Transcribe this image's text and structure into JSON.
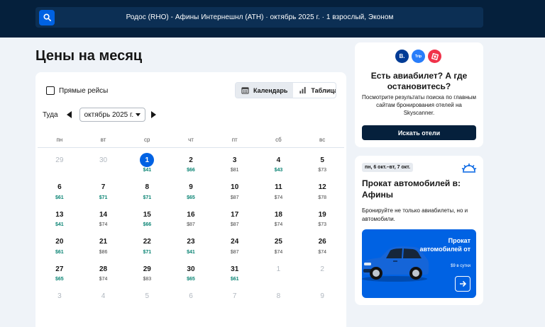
{
  "header": {
    "search_summary": "Родос (RHO) - Афины Интернешнл (ATH)  ·  октябрь 2025 г.  ·  1 взрослый, Эконом"
  },
  "page_title": "Цены на месяц",
  "filters": {
    "direct_flights_label": "Прямые рейсы",
    "direct_flights_checked": false,
    "views": [
      {
        "label": "Календарь",
        "icon": "calendar-icon",
        "active": true
      },
      {
        "label": "Таблица",
        "icon": "bar-chart-icon",
        "active": false
      }
    ]
  },
  "month_nav": {
    "direction_label": "Туда",
    "selected_month": "октябрь 2025 г."
  },
  "weekdays": [
    "пн",
    "вт",
    "ср",
    "чт",
    "пт",
    "сб",
    "вс"
  ],
  "days": [
    {
      "day": "29",
      "price": "",
      "state": "muted"
    },
    {
      "day": "30",
      "price": "",
      "state": "muted"
    },
    {
      "day": "1",
      "price": "$41",
      "state": "selected",
      "level": "low"
    },
    {
      "day": "2",
      "price": "$66",
      "level": "low"
    },
    {
      "day": "3",
      "price": "$81",
      "level": "mid"
    },
    {
      "day": "4",
      "price": "$43",
      "level": "low"
    },
    {
      "day": "5",
      "price": "$73",
      "level": "mid"
    },
    {
      "day": "6",
      "price": "$61",
      "level": "low"
    },
    {
      "day": "7",
      "price": "$71",
      "level": "low"
    },
    {
      "day": "8",
      "price": "$71",
      "level": "low"
    },
    {
      "day": "9",
      "price": "$65",
      "level": "low"
    },
    {
      "day": "10",
      "price": "$87",
      "level": "mid"
    },
    {
      "day": "11",
      "price": "$74",
      "level": "mid"
    },
    {
      "day": "12",
      "price": "$78",
      "level": "mid"
    },
    {
      "day": "13",
      "price": "$41",
      "level": "low"
    },
    {
      "day": "14",
      "price": "$74",
      "level": "mid"
    },
    {
      "day": "15",
      "price": "$66",
      "level": "low"
    },
    {
      "day": "16",
      "price": "$87",
      "level": "mid"
    },
    {
      "day": "17",
      "price": "$87",
      "level": "mid"
    },
    {
      "day": "18",
      "price": "$74",
      "level": "mid"
    },
    {
      "day": "19",
      "price": "$73",
      "level": "mid"
    },
    {
      "day": "20",
      "price": "$61",
      "level": "low"
    },
    {
      "day": "21",
      "price": "$86",
      "level": "mid"
    },
    {
      "day": "22",
      "price": "$71",
      "level": "low"
    },
    {
      "day": "23",
      "price": "$41",
      "level": "low"
    },
    {
      "day": "24",
      "price": "$87",
      "level": "mid"
    },
    {
      "day": "25",
      "price": "$74",
      "level": "mid"
    },
    {
      "day": "26",
      "price": "$74",
      "level": "mid"
    },
    {
      "day": "27",
      "price": "$65",
      "level": "low"
    },
    {
      "day": "28",
      "price": "$74",
      "level": "mid"
    },
    {
      "day": "29",
      "price": "$83",
      "level": "mid"
    },
    {
      "day": "30",
      "price": "$65",
      "level": "low"
    },
    {
      "day": "31",
      "price": "$61",
      "level": "low"
    },
    {
      "day": "1",
      "price": "",
      "state": "muted"
    },
    {
      "day": "2",
      "price": "",
      "state": "muted"
    },
    {
      "day": "3",
      "price": "",
      "state": "muted"
    },
    {
      "day": "4",
      "price": "",
      "state": "muted"
    },
    {
      "day": "5",
      "price": "",
      "state": "muted"
    },
    {
      "day": "6",
      "price": "",
      "state": "muted"
    },
    {
      "day": "7",
      "price": "",
      "state": "muted"
    },
    {
      "day": "8",
      "price": "",
      "state": "muted"
    },
    {
      "day": "9",
      "price": "",
      "state": "muted"
    }
  ],
  "hotels_card": {
    "logos": [
      {
        "text": "B.",
        "color": "#003b95",
        "icon": "booking-logo-icon"
      },
      {
        "text": "Trip",
        "color": "#287dfa",
        "icon": "trip-logo-icon"
      },
      {
        "text": "",
        "color": "#f0324a",
        "icon": "hotel-logo-icon"
      }
    ],
    "title": "Есть авиабилет? А где остановитесь?",
    "description": "Посмотрите результаты поиска по главным сайтам бронирования отелей на Skyscanner.",
    "button_label": "Искать отели"
  },
  "cars_card": {
    "date_badge": "пн, 6 окт.–вт, 7 окт.",
    "title": "Прокат автомобилей в: Афины",
    "description": "Бронируйте не только авиабилеты, но и автомобили.",
    "promo_text": "Прокат автомобилей от",
    "promo_price": "$9 в сутки"
  },
  "colors": {
    "accent": "#0062e3",
    "navy": "#05203c",
    "low_price": "#0b8474"
  }
}
